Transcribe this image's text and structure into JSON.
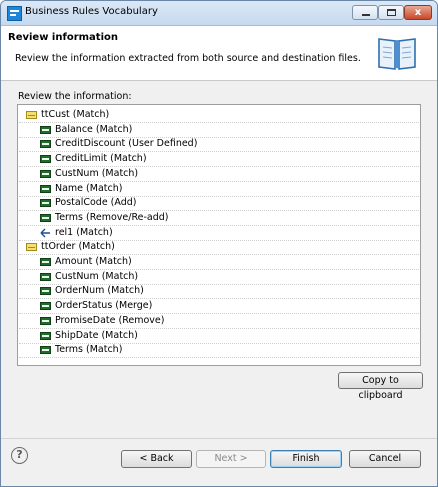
{
  "window": {
    "title": "Business Rules Vocabulary",
    "close_glyph": "x"
  },
  "header": {
    "title": "Review information",
    "description": "Review the information extracted from both source and destination files.",
    "icon": "book-icon"
  },
  "review_label": "Review the information:",
  "tree": [
    {
      "label": "ttCust (Match)",
      "icon": "table",
      "level": 0
    },
    {
      "label": "Balance (Match)",
      "icon": "field",
      "level": 1
    },
    {
      "label": "CreditDiscount (User Defined)",
      "icon": "field",
      "level": 1
    },
    {
      "label": "CreditLimit (Match)",
      "icon": "field",
      "level": 1
    },
    {
      "label": "CustNum (Match)",
      "icon": "field",
      "level": 1
    },
    {
      "label": "Name (Match)",
      "icon": "field",
      "level": 1
    },
    {
      "label": "PostalCode (Add)",
      "icon": "field",
      "level": 1
    },
    {
      "label": "Terms (Remove/Re-add)",
      "icon": "field",
      "level": 1
    },
    {
      "label": "rel1 (Match)",
      "icon": "relation",
      "level": 1
    },
    {
      "label": "ttOrder (Match)",
      "icon": "table",
      "level": 0
    },
    {
      "label": "Amount (Match)",
      "icon": "field",
      "level": 1
    },
    {
      "label": "CustNum (Match)",
      "icon": "field",
      "level": 1
    },
    {
      "label": "OrderNum (Match)",
      "icon": "field",
      "level": 1
    },
    {
      "label": "OrderStatus (Merge)",
      "icon": "field",
      "level": 1
    },
    {
      "label": "PromiseDate (Remove)",
      "icon": "field",
      "level": 1
    },
    {
      "label": "ShipDate (Match)",
      "icon": "field",
      "level": 1
    },
    {
      "label": "Terms (Match)",
      "icon": "field",
      "level": 1
    }
  ],
  "buttons": {
    "copy": "Copy to clipboard",
    "back": "< Back",
    "next": "Next >",
    "finish": "Finish",
    "cancel": "Cancel",
    "help": "?"
  }
}
